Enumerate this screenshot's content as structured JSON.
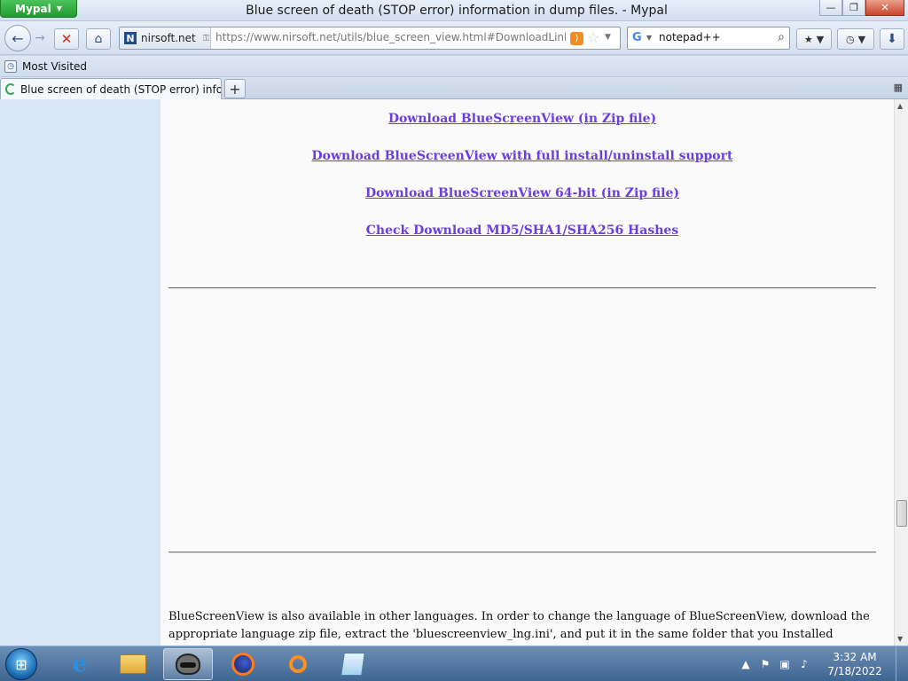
{
  "window": {
    "app_menu_label": "Mypal",
    "title": "Blue screen of death (STOP error) information in dump files. - Mypal",
    "minimize_glyph": "—",
    "maximize_glyph": "❐",
    "close_glyph": "✕"
  },
  "toolbar": {
    "site_name": "nirsoft.net",
    "site_favicon": "N",
    "url": "https://www.nirsoft.net/utils/blue_screen_view.html#DownloadLinks",
    "search_engine": "G",
    "search_value": "notepad++"
  },
  "bookmarks_bar": {
    "items": [
      {
        "label": "Most Visited"
      }
    ]
  },
  "tabs": [
    {
      "label": "Blue screen of death (STOP error) inform..."
    }
  ],
  "page": {
    "download_links": [
      "Download BlueScreenView (in Zip file)",
      "Download BlueScreenView with full install/uninstall support",
      "Download BlueScreenView 64-bit (in Zip file)",
      "Check Download MD5/SHA1/SHA256 Hashes"
    ],
    "language_paragraph": "BlueScreenView is also available in other languages. In order to change the language of BlueScreenView, download the appropriate language zip file, extract the 'bluescreenview_lng.ini', and put it in the same folder that you Installed BlueScreenView utility."
  },
  "taskbar": {
    "clock_time": "3:32 AM",
    "clock_date": "7/18/2022",
    "ie_glyph": "e"
  },
  "colors": {
    "link": "#6b3ee0",
    "sidebar": "#d8e6f6",
    "app_button": "#239a2f"
  }
}
